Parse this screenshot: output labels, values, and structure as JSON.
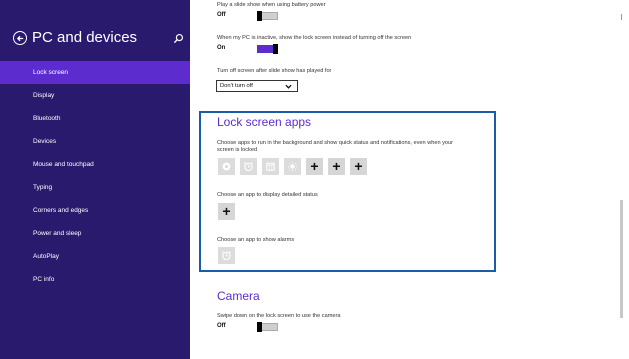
{
  "sidebar": {
    "title": "PC and devices",
    "items": [
      {
        "label": "Lock screen",
        "active": true
      },
      {
        "label": "Display"
      },
      {
        "label": "Bluetooth"
      },
      {
        "label": "Devices"
      },
      {
        "label": "Mouse and touchpad"
      },
      {
        "label": "Typing"
      },
      {
        "label": "Corners and edges"
      },
      {
        "label": "Power and sleep"
      },
      {
        "label": "AutoPlay"
      },
      {
        "label": "PC info"
      }
    ]
  },
  "settings": {
    "battery_slideshow": {
      "label": "Play a slide show when using battery power",
      "state": "Off"
    },
    "inactive_lock": {
      "label": "When my PC is inactive, show the lock screen instead of turning off the screen",
      "state": "On"
    },
    "turn_off_screen": {
      "label": "Turn off screen after slide show has played for",
      "value": "Don't turn off"
    }
  },
  "lock_screen_apps": {
    "title": "Lock screen apps",
    "description_line1": "Choose apps to run in the background and show quick status and notifications, even when your",
    "description_line2": "screen is locked",
    "app_icons": [
      "settings-icon",
      "alarm-icon",
      "calendar-icon",
      "weather-icon"
    ],
    "add_symbol": "+",
    "detailed_status_label": "Choose an app to display detailed status",
    "alarms_label": "Choose an app to show alarms"
  },
  "camera": {
    "title": "Camera",
    "label": "Swipe down on the lock screen to use the camera",
    "state": "Off"
  },
  "colors": {
    "sidebar_bg": "#2a1a6e",
    "accent": "#5d2ccf",
    "highlight_border": "#1a5ca8"
  }
}
